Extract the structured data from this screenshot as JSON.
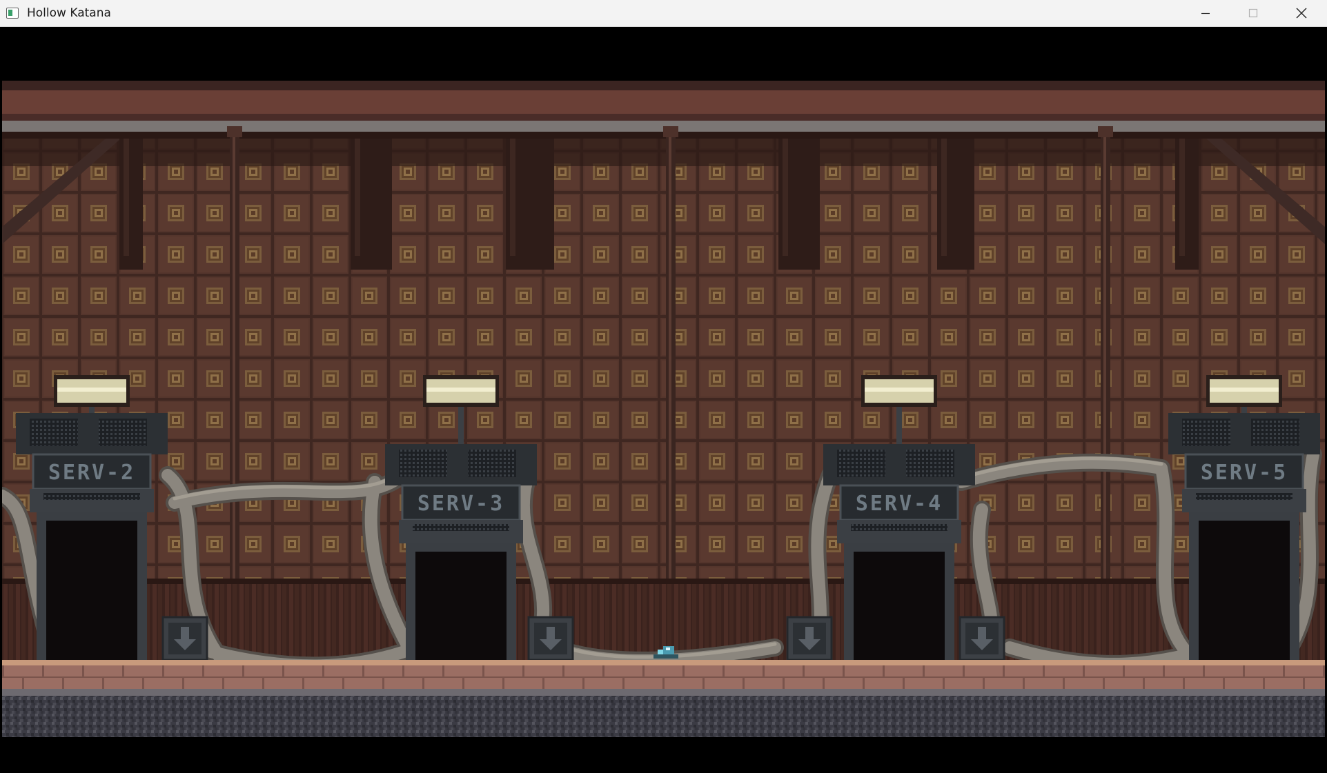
{
  "window": {
    "title": "Hollow Katana"
  },
  "scene": {
    "servers": [
      {
        "label": "SERV-2"
      },
      {
        "label": "SERV-3"
      },
      {
        "label": "SERV-4"
      },
      {
        "label": "SERV-5"
      }
    ]
  },
  "icons": {
    "app": "app-window-icon",
    "minimize": "minimize-icon",
    "maximize": "maximize-icon",
    "close": "close-icon",
    "down_arrow": "down-arrow-icon"
  },
  "colors": {
    "wall": "#4a2e26",
    "wall_tile": "#5b3a2f",
    "tile_highlight": "#8a6a45",
    "pipe": "#8a8478",
    "pipe_shadow": "#5f5a55",
    "server_body": "#2e3236",
    "sign_text": "#6e7a82",
    "lamp": "#d9d5b0",
    "floor": "#b78a6e",
    "player": "#7fd6e6"
  }
}
